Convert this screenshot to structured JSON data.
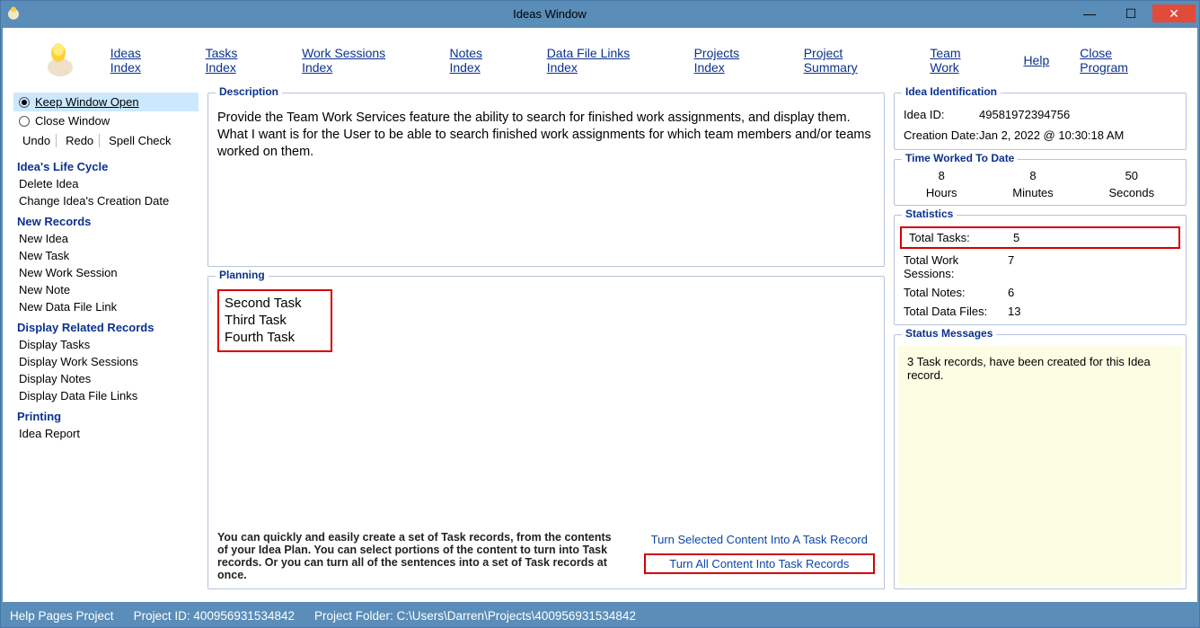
{
  "window": {
    "title": "Ideas Window"
  },
  "menu": {
    "ideas_index": "Ideas Index",
    "tasks_index": "Tasks Index",
    "work_sessions_index": "Work Sessions Index",
    "notes_index": "Notes Index",
    "data_file_links_index": "Data File Links Index",
    "projects_index": "Projects Index",
    "project_summary": "Project Summary",
    "team_work": "Team Work",
    "help": "Help",
    "close_program": "Close Program"
  },
  "sidebar": {
    "keep_open": "Keep Window Open",
    "close_window": "Close Window",
    "undo": "Undo",
    "redo": "Redo",
    "spell": "Spell Check",
    "life_cycle_heading": "Idea's Life Cycle",
    "delete_idea": "Delete Idea",
    "change_date": "Change Idea's Creation Date",
    "new_records_heading": "New Records",
    "new_idea": "New Idea",
    "new_task": "New Task",
    "new_work_session": "New Work Session",
    "new_note": "New Note",
    "new_data_file_link": "New Data File Link",
    "display_heading": "Display Related Records",
    "display_tasks": "Display Tasks",
    "display_work_sessions": "Display Work Sessions",
    "display_notes": "Display Notes",
    "display_data_file_links": "Display Data File Links",
    "printing_heading": "Printing",
    "idea_report": "Idea Report"
  },
  "description": {
    "legend": "Description",
    "text": "Provide the Team Work Services feature the ability to search for finished work assignments, and display them. What I want is for the User to be able to search finished work assignments for which team members and/or teams worked on them."
  },
  "planning": {
    "legend": "Planning",
    "tasks": [
      "Second Task",
      "Third Task",
      "Fourth Task"
    ],
    "hint": "You can quickly and easily create a set of Task records, from the contents of your Idea Plan. You can select portions of the content to turn into Task records. Or you can turn all of the sentences into a set of Task records at once.",
    "turn_selected": "Turn Selected Content Into A Task Record",
    "turn_all": "Turn All Content Into Task Records"
  },
  "identification": {
    "legend": "Idea Identification",
    "idea_id_label": "Idea ID:",
    "idea_id": "49581972394756",
    "creation_label": "Creation Date:",
    "creation": "Jan  2, 2022 @ 10:30:18 AM"
  },
  "time_worked": {
    "legend": "Time Worked To Date",
    "hours_v": "8",
    "hours_l": "Hours",
    "minutes_v": "8",
    "minutes_l": "Minutes",
    "seconds_v": "50",
    "seconds_l": "Seconds"
  },
  "statistics": {
    "legend": "Statistics",
    "total_tasks_l": "Total Tasks:",
    "total_tasks_v": "5",
    "total_ws_l": "Total Work Sessions:",
    "total_ws_v": "7",
    "total_notes_l": "Total Notes:",
    "total_notes_v": "6",
    "total_dfl_l": "Total Data Files:",
    "total_dfl_v": "13"
  },
  "status": {
    "legend": "Status Messages",
    "msg": "3 Task records, have been created for this Idea record."
  },
  "statusbar": {
    "help_pages": "Help Pages Project",
    "project_id_label": "Project ID:",
    "project_id": "400956931534842",
    "project_folder_label": "Project Folder:",
    "project_folder": "C:\\Users\\Darren\\Projects\\400956931534842"
  }
}
